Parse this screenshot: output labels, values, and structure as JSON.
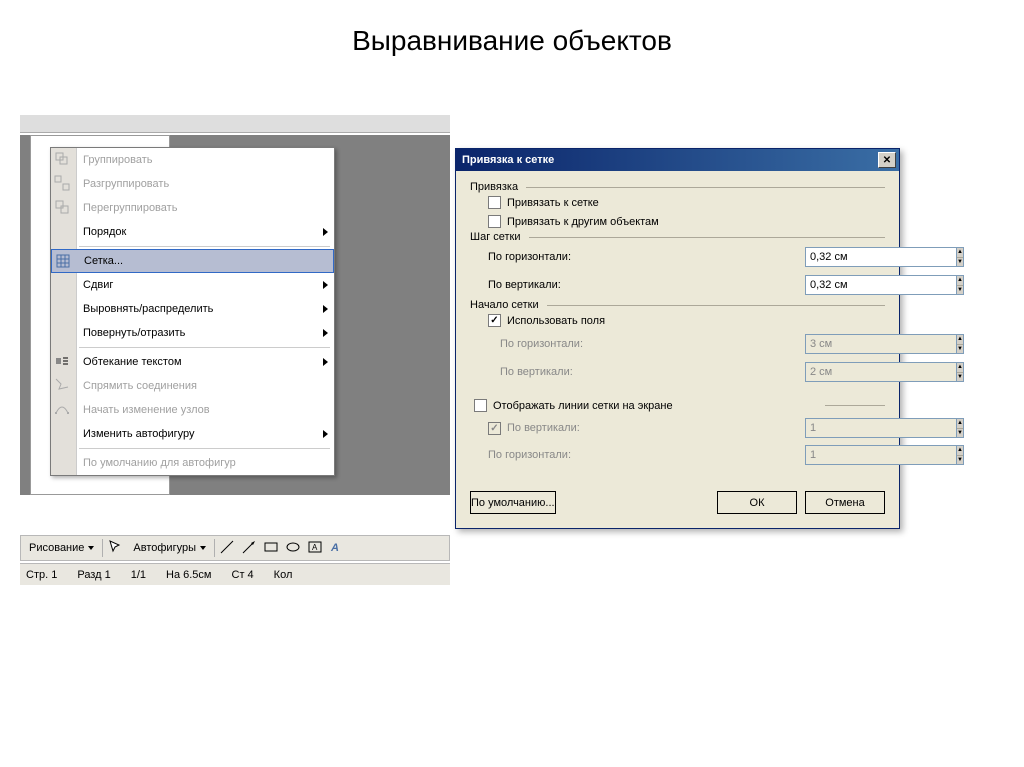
{
  "page": {
    "title": "Выравнивание объектов"
  },
  "menu": {
    "items": [
      {
        "label": "Группировать",
        "disabled": true,
        "icon": "group-icon"
      },
      {
        "label": "Разгруппировать",
        "disabled": true,
        "icon": "ungroup-icon"
      },
      {
        "label": "Перегруппировать",
        "disabled": true,
        "icon": "regroup-icon"
      },
      {
        "label": "Порядок",
        "disabled": false,
        "submenu": true
      },
      {
        "label": "Сетка...",
        "disabled": false,
        "icon": "grid-icon",
        "highlighted": true
      },
      {
        "label": "Сдвиг",
        "disabled": false,
        "submenu": true
      },
      {
        "label": "Выровнять/распределить",
        "disabled": false,
        "submenu": true
      },
      {
        "label": "Повернуть/отразить",
        "disabled": false,
        "submenu": true
      },
      {
        "label": "Обтекание текстом",
        "disabled": false,
        "submenu": true,
        "icon": "wrap-icon"
      },
      {
        "label": "Спрямить соединения",
        "disabled": true,
        "icon": "straighten-icon"
      },
      {
        "label": "Начать изменение узлов",
        "disabled": true,
        "icon": "edit-points-icon"
      },
      {
        "label": "Изменить автофигуру",
        "disabled": false,
        "submenu": true
      },
      {
        "label": "По умолчанию для автофигур",
        "disabled": true
      }
    ]
  },
  "toolbar": {
    "drawing": "Рисование",
    "autoshapes": "Автофигуры"
  },
  "status": {
    "page": "Стр. 1",
    "section": "Разд 1",
    "pages": "1/1",
    "at": "На 6.5см",
    "line": "Ст 4",
    "col": "Кол"
  },
  "dialog": {
    "title": "Привязка к сетке",
    "snap": {
      "label": "Привязка",
      "to_grid": "Привязать к сетке",
      "to_objects": "Привязать к другим объектам"
    },
    "spacing": {
      "label": "Шаг сетки",
      "horizontal_label": "По горизонтали:",
      "horizontal_value": "0,32 см",
      "vertical_label": "По вертикали:",
      "vertical_value": "0,32 см"
    },
    "origin": {
      "label": "Начало сетки",
      "use_margins": "Использовать поля",
      "horizontal_label": "По горизонтали:",
      "horizontal_value": "3 см",
      "vertical_label": "По вертикали:",
      "vertical_value": "2 см"
    },
    "display": {
      "show_grid": "Отображать линии сетки на экране",
      "vertical_label": "По вертикали:",
      "vertical_value": "1",
      "horizontal_label": "По горизонтали:",
      "horizontal_value": "1"
    },
    "buttons": {
      "defaults": "По умолчанию...",
      "ok": "ОК",
      "cancel": "Отмена"
    }
  }
}
